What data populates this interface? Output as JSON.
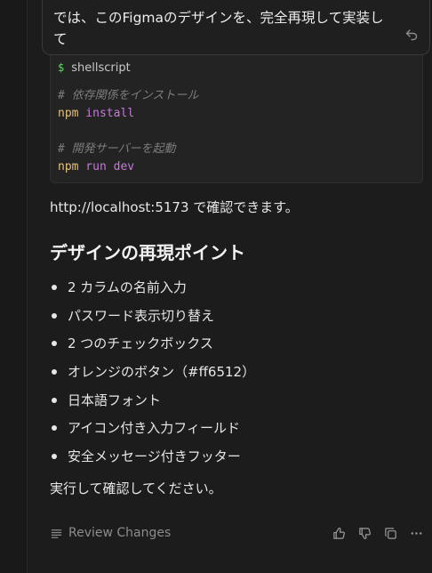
{
  "user_message": {
    "text": "では、このFigmaのデザインを、完全再現して実装して"
  },
  "code_block": {
    "language": "shellscript",
    "lines": [
      {
        "kind": "comment",
        "text": "# 依存関係をインストール"
      },
      {
        "kind": "command",
        "cmd": "npm",
        "args": "install"
      },
      {
        "kind": "blank",
        "text": ""
      },
      {
        "kind": "comment",
        "text": "# 開発サーバーを起動"
      },
      {
        "kind": "command",
        "cmd": "npm",
        "args": "run dev"
      }
    ]
  },
  "response": {
    "url_line": "http://localhost:5173 で確認できます。",
    "heading": "デザインの再現ポイント",
    "bullets": [
      "2 カラムの名前入力",
      "パスワード表示切り替え",
      "2 つのチェックボックス",
      "オレンジのボタン（#ff6512）",
      "日本語フォント",
      "アイコン付き入力フィールド",
      "安全メッセージ付きフッター"
    ],
    "closing": "実行して確認してください。"
  },
  "footer": {
    "review_label": "Review Changes",
    "icons": [
      "thumbs-up-icon",
      "thumbs-down-icon",
      "copy-icon",
      "more-icon"
    ]
  },
  "colors": {
    "background": "#1c1c1c",
    "code_background": "#232323",
    "comment": "#7c7c7c",
    "command": "#e5c07b",
    "argument": "#c678dd"
  }
}
